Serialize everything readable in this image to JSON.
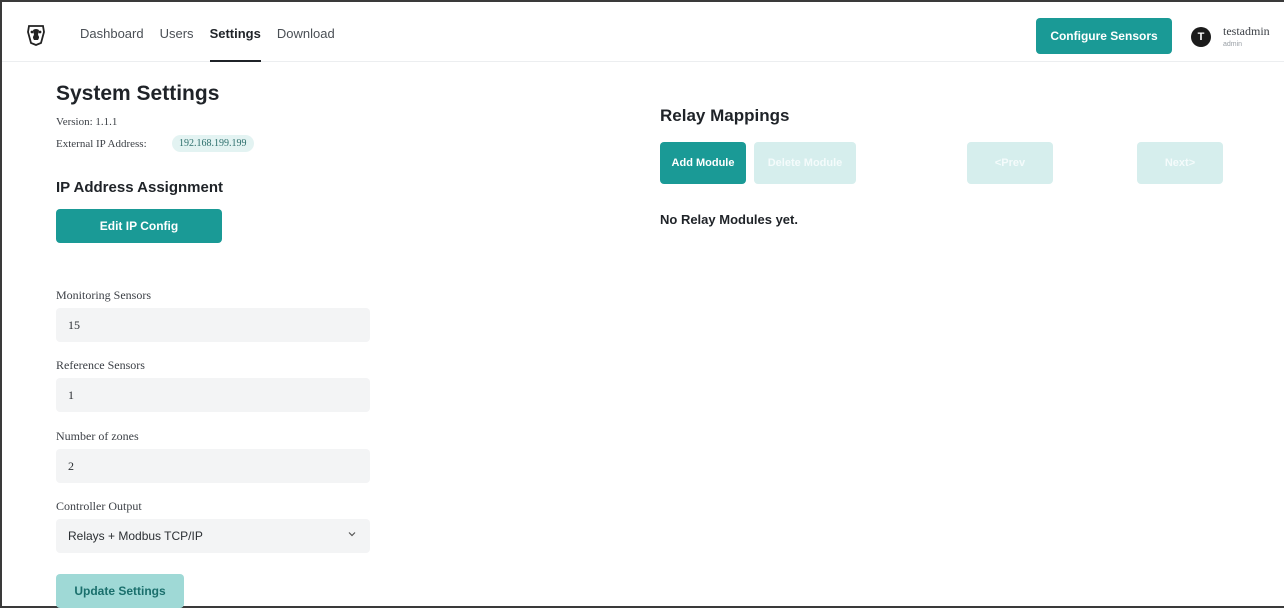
{
  "header": {
    "nav": [
      "Dashboard",
      "Users",
      "Settings",
      "Download"
    ],
    "active_nav": "Settings",
    "configure_label": "Configure Sensors",
    "user": {
      "initial": "T",
      "name": "testadmin",
      "role": "admin"
    }
  },
  "system": {
    "title": "System Settings",
    "version": "Version: 1.1.1",
    "external_ip_label": "External IP Address:",
    "external_ip": "192.168.199.199",
    "ip_section_title": "IP Address Assignment",
    "edit_ip_label": "Edit IP Config",
    "fields": [
      {
        "label": "Monitoring Sensors",
        "value": "15"
      },
      {
        "label": "Reference Sensors",
        "value": "1"
      },
      {
        "label": "Number of zones",
        "value": "2"
      }
    ],
    "controller_output_label": "Controller Output",
    "controller_output_value": "Relays + Modbus TCP/IP",
    "update_label": "Update Settings"
  },
  "relay": {
    "title": "Relay Mappings",
    "add_label": "Add Module",
    "delete_label": "Delete Module",
    "prev_label": "<Prev",
    "next_label": "Next>",
    "empty_message": "No Relay Modules yet."
  },
  "colors": {
    "accent": "#1a9a96",
    "accent_disabled": "#d6eeed",
    "accent_light": "#9fd9d6"
  },
  "icons": {
    "logo": "app-logo-icon",
    "chevron": "chevron-down-icon"
  }
}
